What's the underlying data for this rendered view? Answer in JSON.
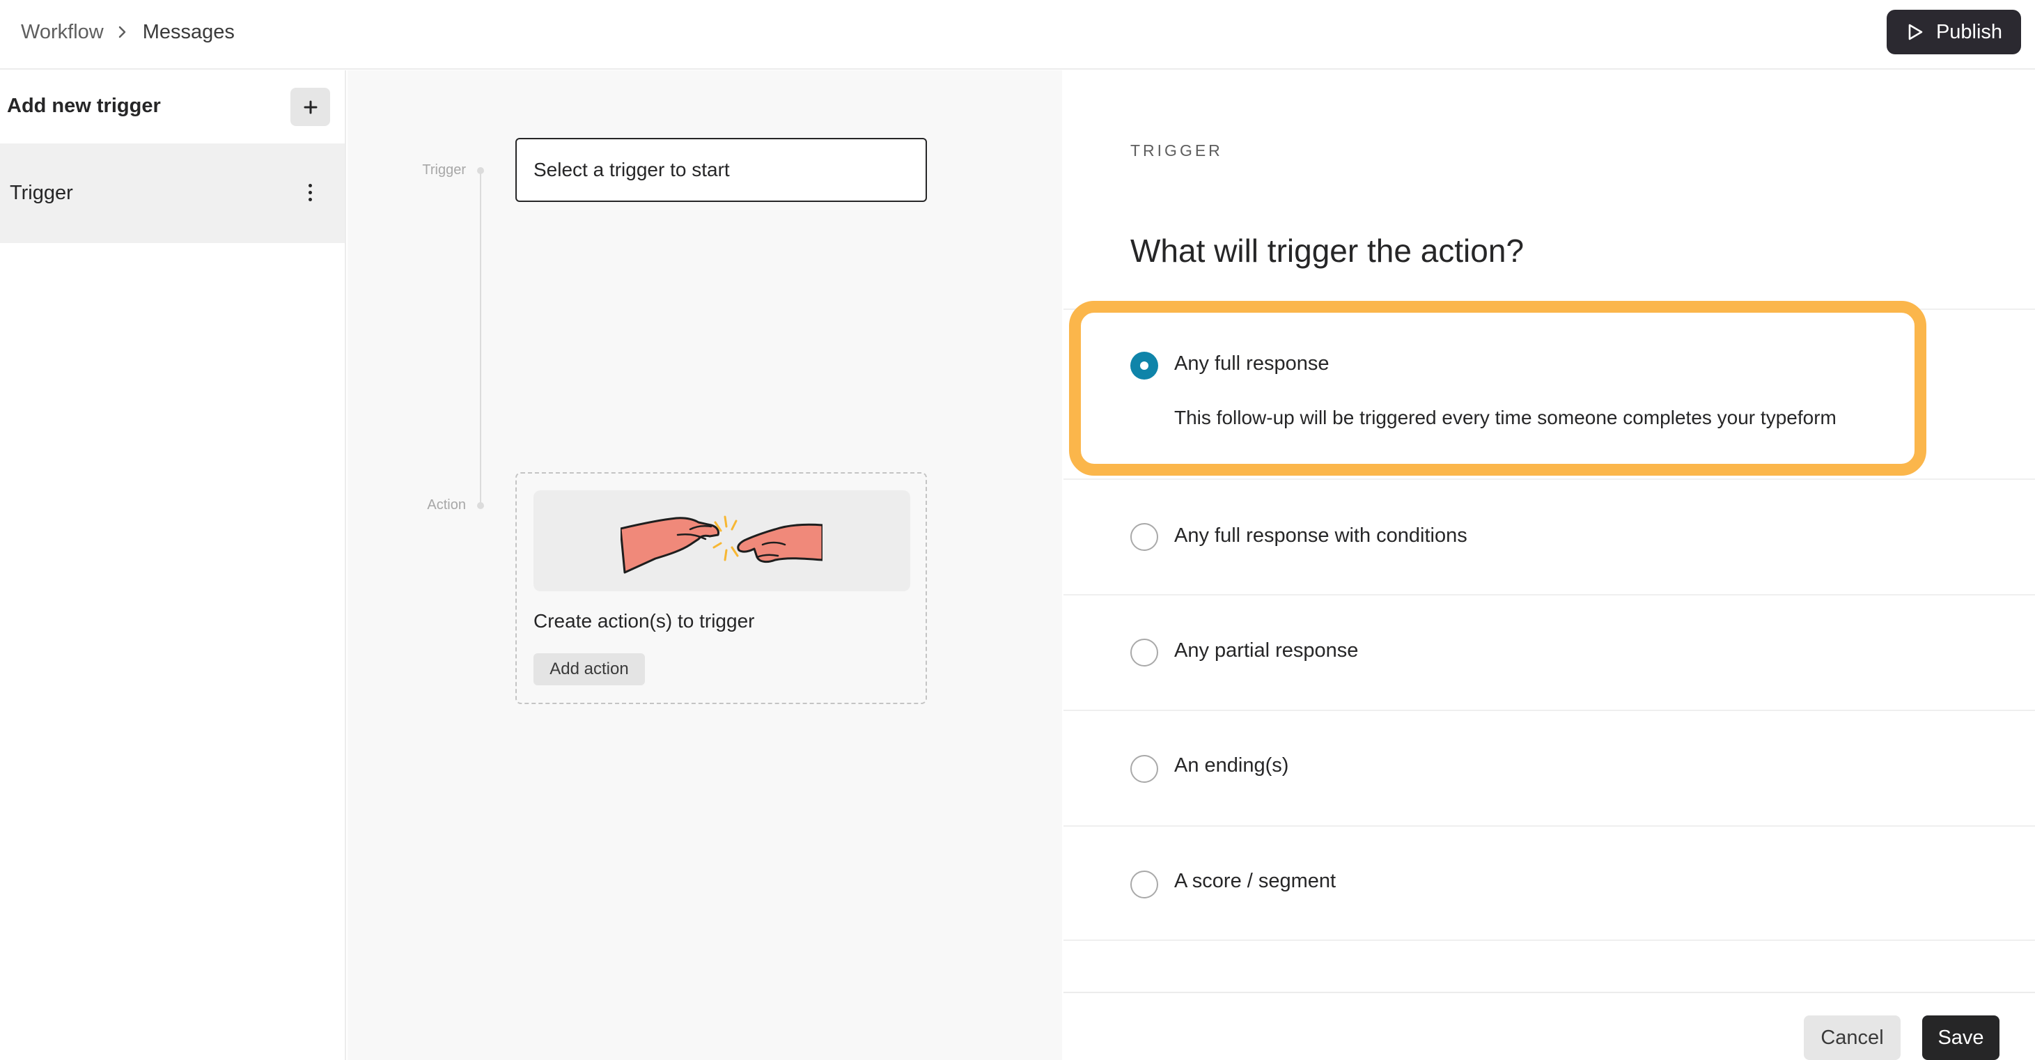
{
  "header": {
    "breadcrumb_root": "Workflow",
    "breadcrumb_current": "Messages",
    "publish_label": "Publish"
  },
  "sidebar": {
    "title": "Add new trigger",
    "items": [
      {
        "label": "Trigger"
      }
    ]
  },
  "canvas": {
    "trigger_step_label": "Trigger",
    "action_step_label": "Action",
    "trigger_placeholder": "Select a trigger to start",
    "action_title": "Create action(s) to trigger",
    "add_action_label": "Add action"
  },
  "panel": {
    "eyebrow": "TRIGGER",
    "question": "What will trigger the action?",
    "options": [
      {
        "label": "Any full response",
        "description": "This follow-up will be triggered every time someone completes your typeform",
        "selected": true
      },
      {
        "label": "Any full response with conditions",
        "selected": false
      },
      {
        "label": "Any partial response",
        "selected": false
      },
      {
        "label": "An ending(s)",
        "selected": false
      },
      {
        "label": "A score / segment",
        "selected": false
      }
    ],
    "cancel_label": "Cancel",
    "save_label": "Save"
  },
  "colors": {
    "accent": "#0f84a9",
    "highlight": "#fbb64b",
    "primary_button": "#262627",
    "illustration_skin": "#f0897a"
  },
  "icons": [
    "chevron-right-icon",
    "play-outline-icon",
    "plus-icon",
    "kebab-menu-icon",
    "hands-touching-illustration"
  ]
}
